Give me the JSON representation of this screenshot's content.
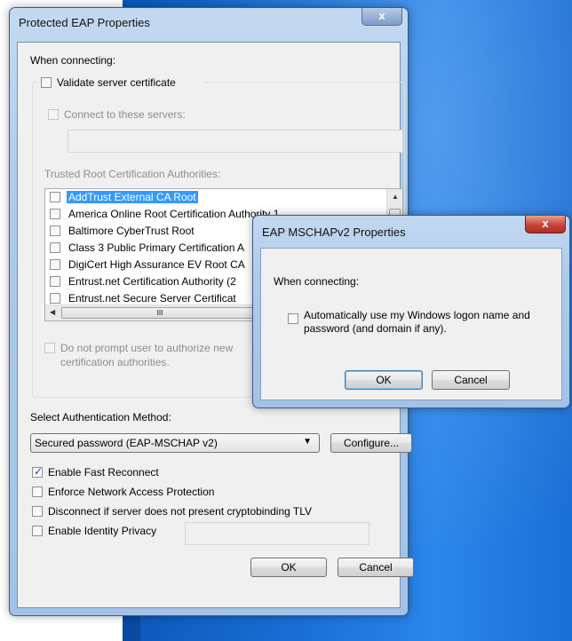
{
  "main_dialog": {
    "title": "Protected EAP Properties",
    "close_label": "x",
    "when_connecting": "When connecting:",
    "validate_cert": {
      "label": "Validate server certificate",
      "checked": false
    },
    "connect_servers": {
      "label": "Connect to these servers:",
      "checked": false,
      "value": ""
    },
    "trusted_root_label": "Trusted Root Certification Authorities:",
    "ca_list": [
      {
        "label": "AddTrust External CA Root",
        "checked": false,
        "selected": true
      },
      {
        "label": "America Online Root Certification Authority 1",
        "checked": false
      },
      {
        "label": "Baltimore CyberTrust Root",
        "checked": false
      },
      {
        "label": "Class 3 Public Primary Certification A",
        "checked": false
      },
      {
        "label": "DigiCert High Assurance EV Root CA",
        "checked": false
      },
      {
        "label": "Entrust.net Certification Authority (2",
        "checked": false
      },
      {
        "label": "Entrust.net Secure Server Certificat",
        "checked": false
      }
    ],
    "no_prompt": {
      "line1": "Do not prompt user to authorize new",
      "line2": "certification authorities.",
      "checked": false
    },
    "auth_method_label": "Select Authentication Method:",
    "auth_method_value": "Secured password (EAP-MSCHAP v2)",
    "configure_label": "Configure...",
    "options": {
      "fast_reconnect": {
        "label": "Enable Fast Reconnect",
        "checked": true
      },
      "nap": {
        "label": "Enforce Network Access Protection",
        "checked": false
      },
      "cryptobinding": {
        "label": "Disconnect if server does not present cryptobinding TLV",
        "checked": false
      },
      "identity_privacy": {
        "label": "Enable Identity Privacy",
        "checked": false,
        "value": ""
      }
    },
    "ok_label": "OK",
    "cancel_label": "Cancel",
    "scroll_grip": "III"
  },
  "mschap_dialog": {
    "title": "EAP MSCHAPv2 Properties",
    "close_label": "x",
    "when_connecting": "When connecting:",
    "auto_logon": {
      "line1": "Automatically use my Windows logon name and",
      "line2": "password (and domain if any).",
      "checked": false
    },
    "ok_label": "OK",
    "cancel_label": "Cancel"
  }
}
